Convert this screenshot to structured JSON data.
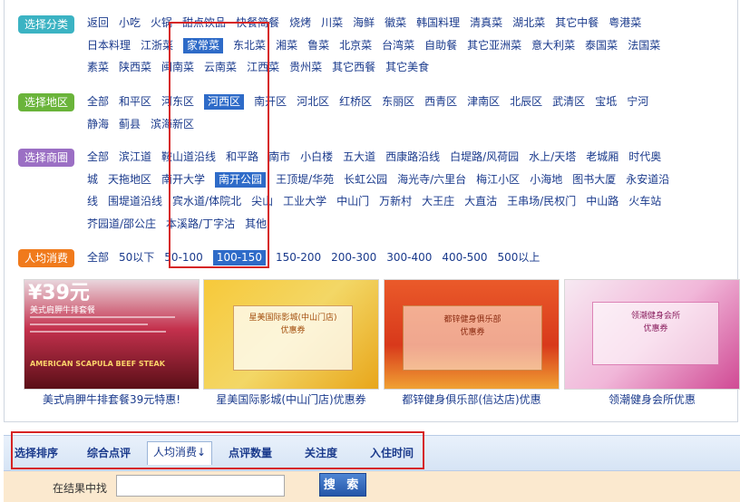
{
  "filters": {
    "cuisine": {
      "label": "选择分类",
      "lines": [
        [
          "返回",
          "小吃",
          "火锅",
          "甜点饮品",
          "快餐简餐",
          "烧烤",
          "川菜",
          "海鲜",
          "徽菜",
          "韩国料理",
          "清真菜",
          "湖北菜",
          "其它中餐",
          "粤港菜"
        ],
        [
          "日本料理",
          "江浙菜",
          "家常菜",
          "东北菜",
          "湘菜",
          "鲁菜",
          "北京菜",
          "台湾菜",
          "自助餐",
          "其它亚洲菜",
          "意大利菜",
          "泰国菜",
          "法国菜"
        ],
        [
          "素菜",
          "陕西菜",
          "闽南菜",
          "云南菜",
          "江西菜",
          "贵州菜",
          "其它西餐",
          "其它美食"
        ]
      ],
      "selected": "家常菜"
    },
    "area": {
      "label": "选择地区",
      "lines": [
        [
          "全部",
          "和平区",
          "河东区",
          "河西区",
          "南开区",
          "河北区",
          "红桥区",
          "东丽区",
          "西青区",
          "津南区",
          "北辰区",
          "武清区",
          "宝坻",
          "宁河"
        ],
        [
          "静海",
          "蓟县",
          "滨海新区"
        ]
      ],
      "selected": "河西区"
    },
    "business": {
      "label": "选择商圈",
      "lines": [
        [
          "全部",
          "滨江道",
          "鞍山道沿线",
          "和平路",
          "南市",
          "小白楼",
          "五大道",
          "西康路沿线",
          "白堤路/风荷园",
          "水上/天塔",
          "老城厢",
          "时代奥"
        ],
        [
          "城",
          "天拖地区",
          "南开大学",
          "南开公园",
          "王顶堤/华苑",
          "长虹公园",
          "海光寺/六里台",
          "梅江小区",
          "小海地",
          "图书大厦",
          "永安道沿"
        ],
        [
          "线",
          "围堤道沿线",
          "宾水道/体院北",
          "尖山",
          "工业大学",
          "中山门",
          "万新村",
          "大王庄",
          "大直沽",
          "王串场/民权门",
          "中山路",
          "火车站"
        ],
        [
          "芥园道/邵公庄",
          "本溪路/丁字沽",
          "其他"
        ]
      ],
      "selected": "南开公园"
    },
    "price": {
      "label": "人均消费",
      "options": [
        "全部",
        "50以下",
        "50-100",
        "100-150",
        "150-200",
        "200-300",
        "300-400",
        "400-500",
        "500以上"
      ],
      "selected": "100-150"
    }
  },
  "banners": [
    {
      "caption": "美式肩胛牛排套餐39元特惠!",
      "headline": "¥39元",
      "subtext": "AMERICAN SCAPULA BEEF STEAK",
      "name": "美式肩胛牛排套餐"
    },
    {
      "caption": "星美国际影城(中山门店)优惠券",
      "headline": "星美国际影城(中山门店)",
      "subtext": "优惠券"
    },
    {
      "caption": "都锌健身俱乐部(信达店)优惠",
      "headline": "都锌健身俱乐部",
      "subtext": "优惠券"
    },
    {
      "caption": "领潮健身会所优惠",
      "headline": "领潮健身会所",
      "subtext": "优惠券"
    }
  ],
  "sort": {
    "title": "选择排序",
    "items": [
      "综合点评",
      "人均消费↓",
      "点评数量",
      "关注度",
      "入住时间"
    ],
    "active": "人均消费↓"
  },
  "search": {
    "label": "在结果中找",
    "value": "",
    "button": "搜 索"
  },
  "colors": {
    "link": "#1a3a8c",
    "selected_bg": "#2e6bc8",
    "annotation_red": "#d62424"
  }
}
